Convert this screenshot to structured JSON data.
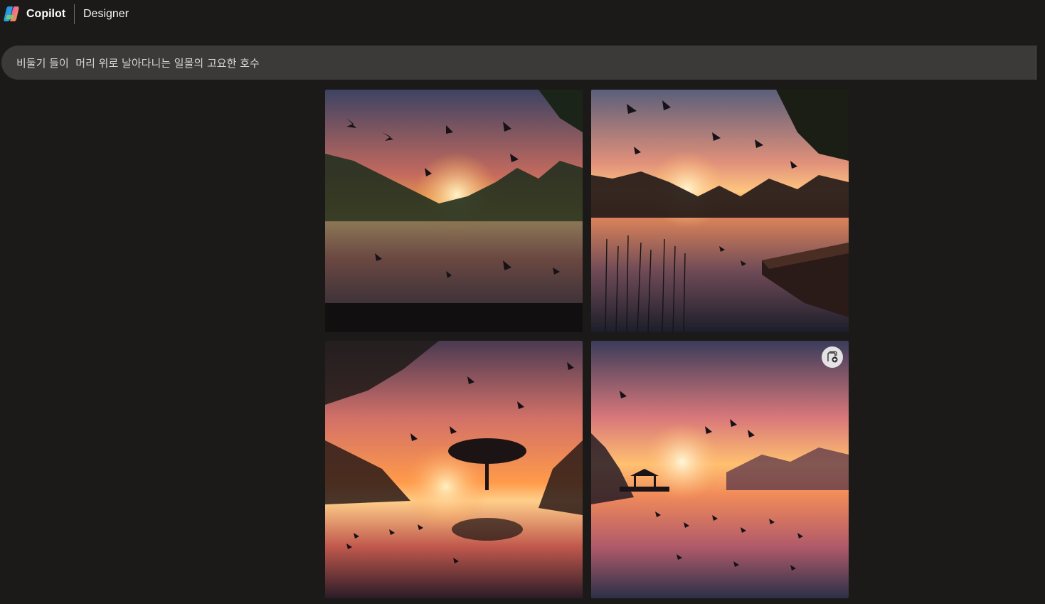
{
  "header": {
    "brand": "Copilot",
    "product": "Designer"
  },
  "prompt": {
    "text": "비둘기 들이  머리 위로 날아다니는 일몰의 고요한 호수"
  },
  "icons": {
    "logo": "copilot-logo-icon",
    "save": "collection-add-icon"
  },
  "colors": {
    "background": "#1b1a19",
    "prompt_bar": "#3b3a39"
  }
}
